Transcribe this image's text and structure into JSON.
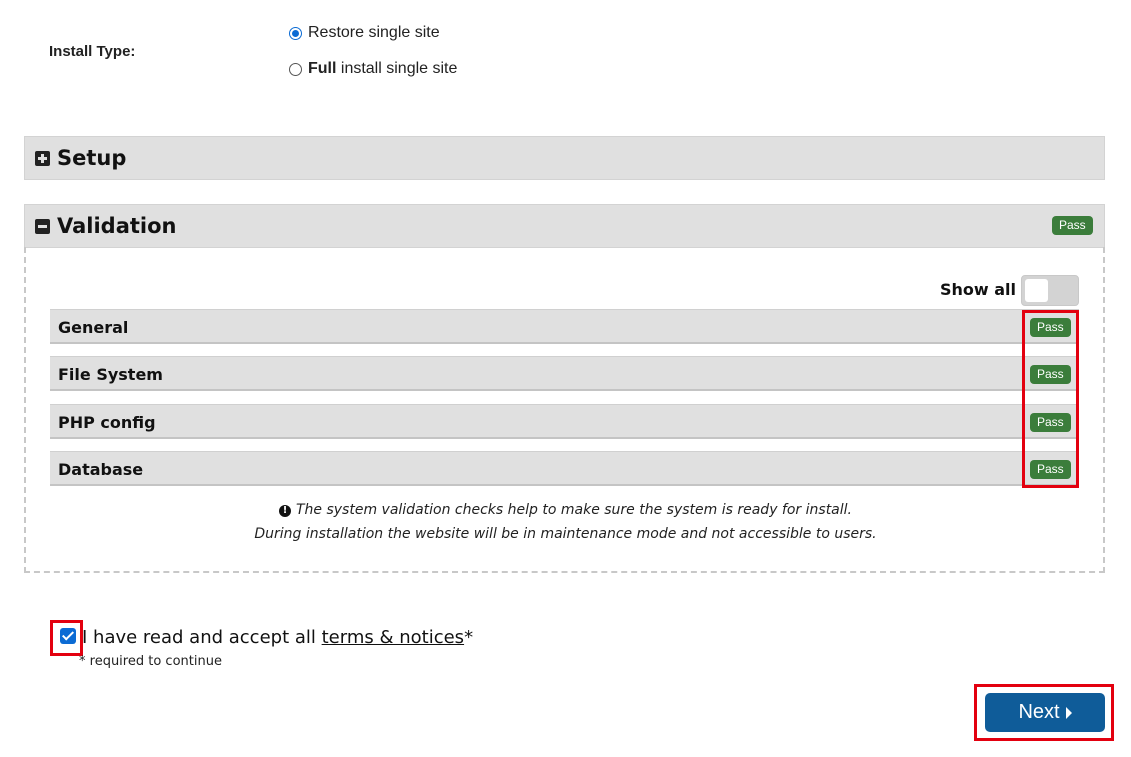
{
  "install": {
    "label": "Install Type:",
    "options": [
      {
        "bold": "",
        "text": "Restore single site",
        "checked": true
      },
      {
        "bold": "Full",
        "text": " install single site",
        "checked": false
      }
    ]
  },
  "sections": {
    "setup": {
      "title": "Setup",
      "icon": "plus-square-icon",
      "expanded": false
    },
    "validation": {
      "title": "Validation",
      "icon": "minus-square-icon",
      "expanded": true,
      "status": "Pass"
    }
  },
  "show_all": {
    "label": "Show all",
    "enabled": false
  },
  "checks": [
    {
      "label": "General",
      "status": "Pass"
    },
    {
      "label": "File System",
      "status": "Pass"
    },
    {
      "label": "PHP config",
      "status": "Pass"
    },
    {
      "label": "Database",
      "status": "Pass"
    }
  ],
  "notes": {
    "line1": "The system validation checks help to make sure the system is ready for install.",
    "line2": "During installation the website will be in maintenance mode and not accessible to users."
  },
  "terms": {
    "checked": true,
    "prefix": "I have read and accept all ",
    "link": "terms & notices",
    "suffix": "*",
    "required_note": "* required to continue"
  },
  "next_button": {
    "label": "Next"
  },
  "colors": {
    "pass_badge": "#3b7d3b",
    "primary": "#0f5c99",
    "highlight": "#e3000f",
    "checkbox": "#0b6bd4"
  }
}
